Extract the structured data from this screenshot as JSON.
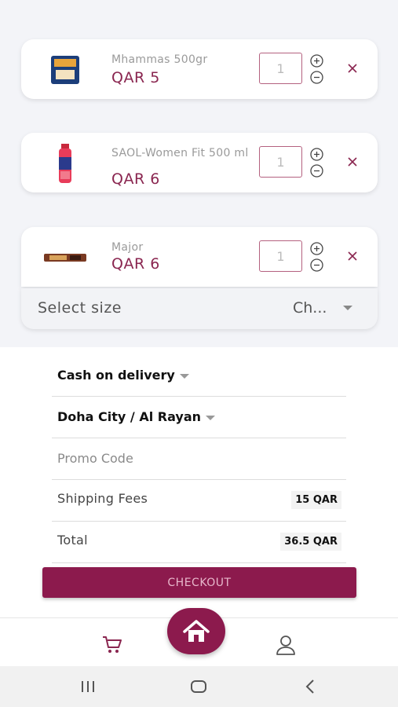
{
  "cart": {
    "items": [
      {
        "name": "Mhammas 500gr",
        "price": "QAR 5",
        "quantity": "1",
        "image_icon": "rice-bag-icon"
      },
      {
        "name": "SAOL-Women Fit 500 ml",
        "price": "QAR 6",
        "quantity": "1",
        "image_icon": "juice-bottle-icon"
      },
      {
        "name": "Major",
        "price": "QAR 6",
        "quantity": "1",
        "image_icon": "snack-bar-icon"
      }
    ],
    "size_selector": {
      "label": "Select size",
      "value": "Ch..."
    }
  },
  "order": {
    "payment_method": "Cash on delivery",
    "location": "Doha City / Al Rayan",
    "promo_placeholder": "Promo Code",
    "shipping_label": "Shipping Fees",
    "shipping_value": "15 QAR",
    "total_label": "Total",
    "total_value": "36.5 QAR",
    "checkout_label": "CHECKOUT"
  },
  "colors": {
    "brand": "#8c1a4d",
    "price": "#8a2650",
    "background": "#f3f4f8"
  },
  "nav": {
    "items": [
      "cart-icon",
      "home-icon",
      "user-icon"
    ]
  }
}
